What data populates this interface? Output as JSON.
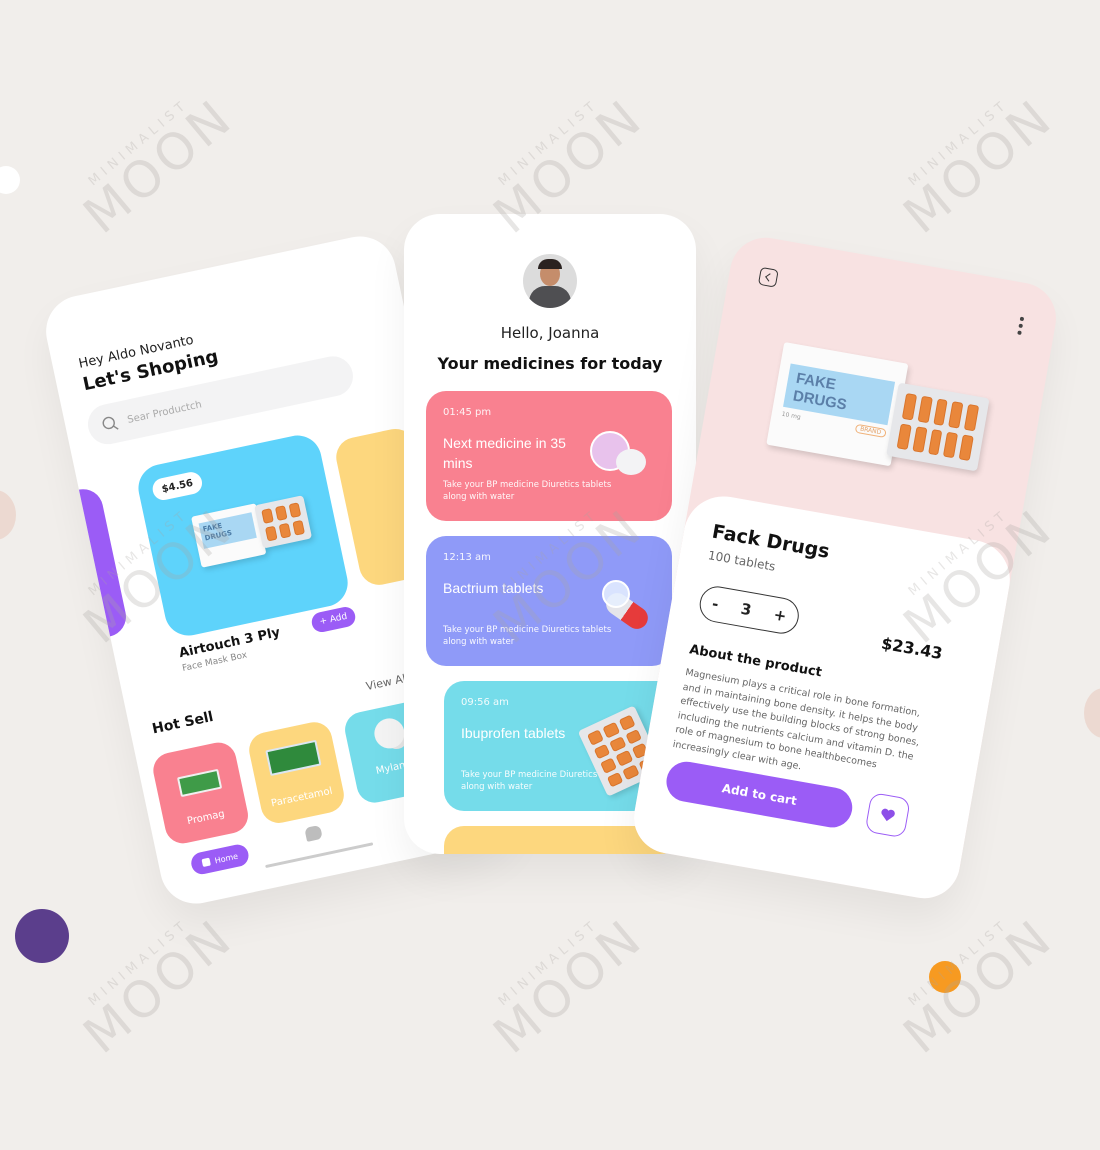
{
  "watermark": {
    "line1": "MINIMALIST",
    "line2": "MOON"
  },
  "colors": {
    "purple": "#9b5cf6",
    "deep_purple": "#5b3e8c",
    "orange": "#f79a21",
    "pink": "#f98190",
    "blue": "#8f9af8",
    "cyan": "#75dcea",
    "yellow": "#fdd77e",
    "sky": "#5ed3fb"
  },
  "shop": {
    "greeting": "Hey Aldo Novanto",
    "title": "Let's Shoping",
    "search_placeholder": "Sear Productch",
    "featured": {
      "price": "$4.56",
      "name": "Airtouch 3 Ply",
      "subtitle": "Face Mask Box",
      "add_label": "+ Add",
      "box_text_1": "FAKE",
      "box_text_2": "DRUGS"
    },
    "hot_sell_title": "Hot Sell",
    "view_all": "View All",
    "hot_items": [
      {
        "name": "Promag"
      },
      {
        "name": "Paracetamol"
      },
      {
        "name": "Mylanta"
      }
    ],
    "nav": {
      "home_label": "Home"
    }
  },
  "meds": {
    "hello": "Hello, Joanna",
    "title": "Your medicines for today",
    "cards": [
      {
        "time": "01:45 pm",
        "title": "Next medicine in 35 mins",
        "desc": "Take your BP medicine Diuretics tablets along with water"
      },
      {
        "time": "12:13 am",
        "title": "Bactrium tablets",
        "desc": "Take your BP medicine Diuretics tablets along with water"
      },
      {
        "time": "09:56 am",
        "title": "Ibuprofen tablets",
        "desc": "Take your BP medicine Diuretics tablets along with water"
      }
    ]
  },
  "detail": {
    "box_text_1": "FAKE",
    "box_text_2": "DRUGS",
    "box_brand": "BRAND",
    "box_dose": "10 mg",
    "name": "Fack Drugs",
    "count": "100 tablets",
    "qty_minus": "-",
    "qty": "3",
    "qty_plus": "+",
    "price": "$23.43",
    "about_title": "About the product",
    "about_text": "Magnesium plays a critical role in bone formation, and in maintaining bone density. it helps the body effectively use the building blocks of strong bones, including the nutrients calcium and vitamin D. the role of magnesium to bone healthbecomes increasingly clear with age.",
    "add_to_cart": "Add to cart"
  }
}
